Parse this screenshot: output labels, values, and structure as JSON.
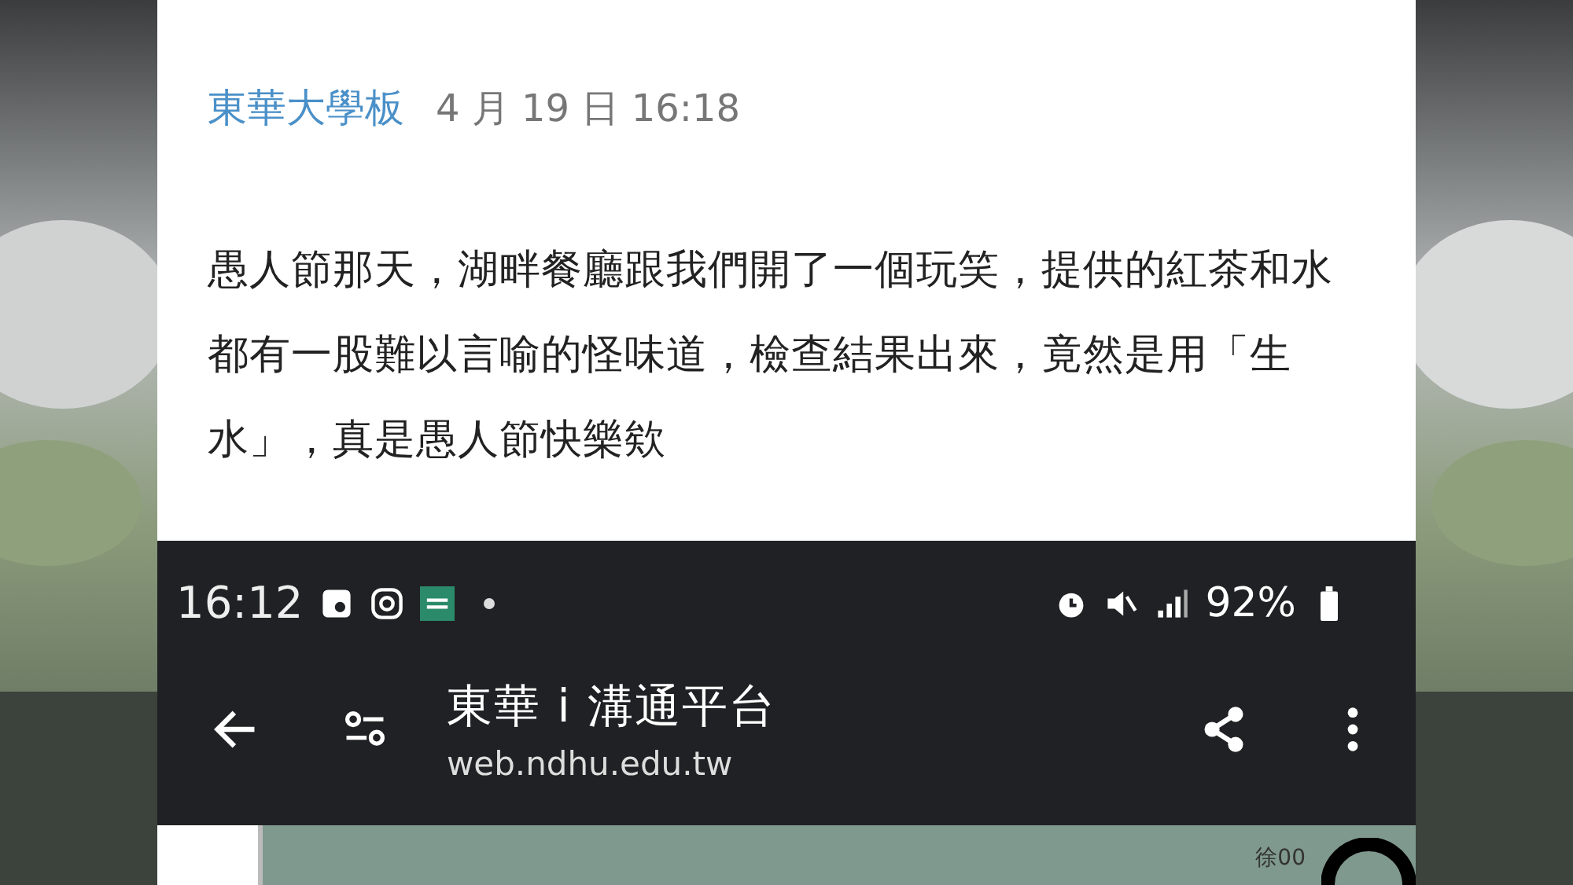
{
  "post": {
    "board": "東華大學板",
    "date": "4 月 19 日 16:18",
    "body": "愚人節那天，湖畔餐廳跟我們開了一個玩笑，提供的紅茶和水都有一股難以言喻的怪味道，檢查結果出來，竟然是用「生水」，真是愚人節快樂欸"
  },
  "status_bar": {
    "time": "16:12",
    "battery": "92%"
  },
  "browser_bar": {
    "title": "東華 i 溝通平台",
    "url": "web.ndhu.edu.tw"
  },
  "page_below": {
    "author": "徐00"
  }
}
